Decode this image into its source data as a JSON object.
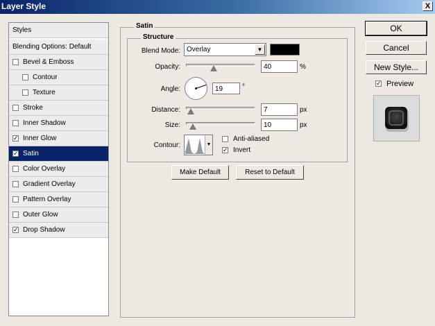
{
  "window": {
    "title": "Layer Style",
    "close_glyph": "X"
  },
  "sidebar": {
    "styles": "Styles",
    "blending": "Blending Options: Default",
    "items": [
      {
        "label": "Bevel & Emboss",
        "checked": false
      },
      {
        "label": "Contour",
        "checked": false
      },
      {
        "label": "Texture",
        "checked": false
      },
      {
        "label": "Stroke",
        "checked": false
      },
      {
        "label": "Inner Shadow",
        "checked": false
      },
      {
        "label": "Inner Glow",
        "checked": true
      },
      {
        "label": "Satin",
        "checked": true,
        "selected": true
      },
      {
        "label": "Color Overlay",
        "checked": false
      },
      {
        "label": "Gradient Overlay",
        "checked": false
      },
      {
        "label": "Pattern Overlay",
        "checked": false
      },
      {
        "label": "Outer Glow",
        "checked": false
      },
      {
        "label": "Drop Shadow",
        "checked": true
      }
    ]
  },
  "satin": {
    "title": "Satin",
    "structure_title": "Structure",
    "blend_mode_label": "Blend Mode:",
    "blend_mode_value": "Overlay",
    "blend_color": "#000000",
    "opacity_label": "Opacity:",
    "opacity_value": "40",
    "opacity_unit": "%",
    "opacity_fraction": 0.4,
    "angle_label": "Angle:",
    "angle_value": "19",
    "angle_unit": "°",
    "distance_label": "Distance:",
    "distance_value": "7",
    "distance_unit": "px",
    "size_label": "Size:",
    "size_value": "10",
    "size_unit": "px",
    "contour_label": "Contour:",
    "anti_aliased_label": "Anti-aliased",
    "anti_aliased_checked": false,
    "invert_label": "Invert",
    "invert_checked": true,
    "make_default": "Make Default",
    "reset_default": "Reset to Default"
  },
  "buttons": {
    "ok": "OK",
    "cancel": "Cancel",
    "new_style": "New Style..."
  },
  "preview": {
    "label": "Preview",
    "checked": true
  },
  "check_glyph": "✓",
  "colors": {
    "title_start": "#0a246a",
    "title_end": "#a6caf0",
    "selected_row": "#0a246a"
  }
}
